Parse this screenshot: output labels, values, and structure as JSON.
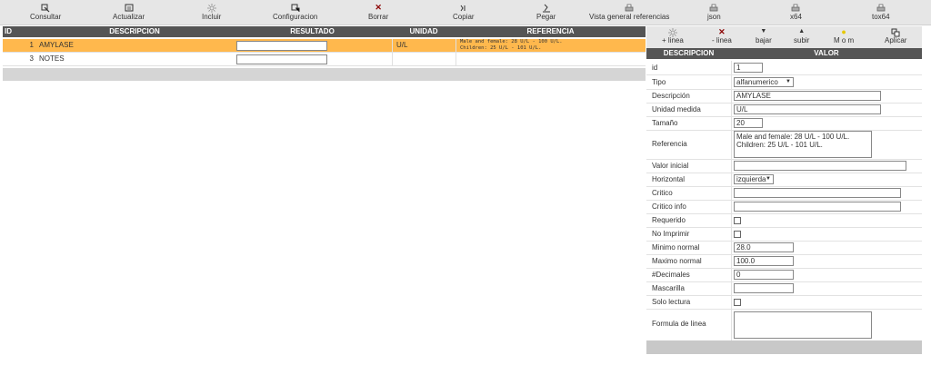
{
  "toolbar": {
    "buttons": [
      {
        "label": "Consultar",
        "icon": "query-icon"
      },
      {
        "label": "Actualizar",
        "icon": "refresh-icon"
      },
      {
        "label": "Incluir",
        "icon": "add-sun-icon"
      },
      {
        "label": "Configuracion",
        "icon": "settings-icon"
      },
      {
        "label": "Borrar",
        "icon": "close-icon"
      },
      {
        "label": "Copiar",
        "icon": "copy-icon"
      },
      {
        "label": "Pegar",
        "icon": "paste-icon"
      },
      {
        "label": "Vista general referencias",
        "icon": "print-icon"
      },
      {
        "label": "json",
        "icon": "print-icon"
      },
      {
        "label": "x64",
        "icon": "print-icon"
      },
      {
        "label": "tox64",
        "icon": "print-icon"
      }
    ]
  },
  "table": {
    "headers": {
      "id": "ID",
      "descripcion": "DESCRIPCION",
      "resultado": "RESULTADO",
      "unidad": "UNIDAD",
      "referencia": "REFERENCIA"
    },
    "rows": [
      {
        "id": "1",
        "descripcion": "AMYLASE",
        "unidad": "U/L",
        "referencia": "Male and female: 28 U/L - 100 U/L.\nChildren: 25 U/L - 101 U/L."
      },
      {
        "id": "3",
        "descripcion": "NOTES",
        "unidad": "",
        "referencia": ""
      }
    ]
  },
  "panel": {
    "buttons": [
      {
        "label": "+ linea",
        "icon": "add-sun-icon"
      },
      {
        "label": "- linea",
        "icon": "close-icon"
      },
      {
        "label": "bajar",
        "icon": "arrow-down-icon"
      },
      {
        "label": "subir",
        "icon": "arrow-up-icon"
      },
      {
        "label": "M o m",
        "icon": "star-icon"
      },
      {
        "label": "Aplicar",
        "icon": "apply-icon"
      }
    ],
    "headers": {
      "descripcion": "DESCRIPCION",
      "valor": "VALOR"
    },
    "props": {
      "id": {
        "label": "id",
        "value": "1"
      },
      "tipo": {
        "label": "Tipo",
        "value": "alfanumerico"
      },
      "descripcion": {
        "label": "Descripción",
        "value": "AMYLASE"
      },
      "unidad": {
        "label": "Unidad medida",
        "value": "U/L"
      },
      "tamano": {
        "label": "Tamaño",
        "value": "20"
      },
      "referencia": {
        "label": "Referencia",
        "value": "Male and female: 28 U/L - 100 U/L.\nChildren: 25 U/L - 101 U/L."
      },
      "valor_inicial": {
        "label": "Valor inicial",
        "value": ""
      },
      "horizontal": {
        "label": "Horizontal",
        "value": "izquierda"
      },
      "critico": {
        "label": "Critico",
        "value": ""
      },
      "critico_info": {
        "label": "Critico info",
        "value": ""
      },
      "requerido": {
        "label": "Requerido"
      },
      "no_imprimir": {
        "label": "No Imprimir"
      },
      "minimo": {
        "label": "Minimo normal",
        "value": "28.0"
      },
      "maximo": {
        "label": "Maximo normal",
        "value": "100.0"
      },
      "decimales": {
        "label": "#Decimales",
        "value": "0"
      },
      "mascarilla": {
        "label": "Mascarilla",
        "value": ""
      },
      "solo_lectura": {
        "label": "Solo lectura"
      },
      "formula": {
        "label": "Formula de linea",
        "value": ""
      }
    }
  }
}
